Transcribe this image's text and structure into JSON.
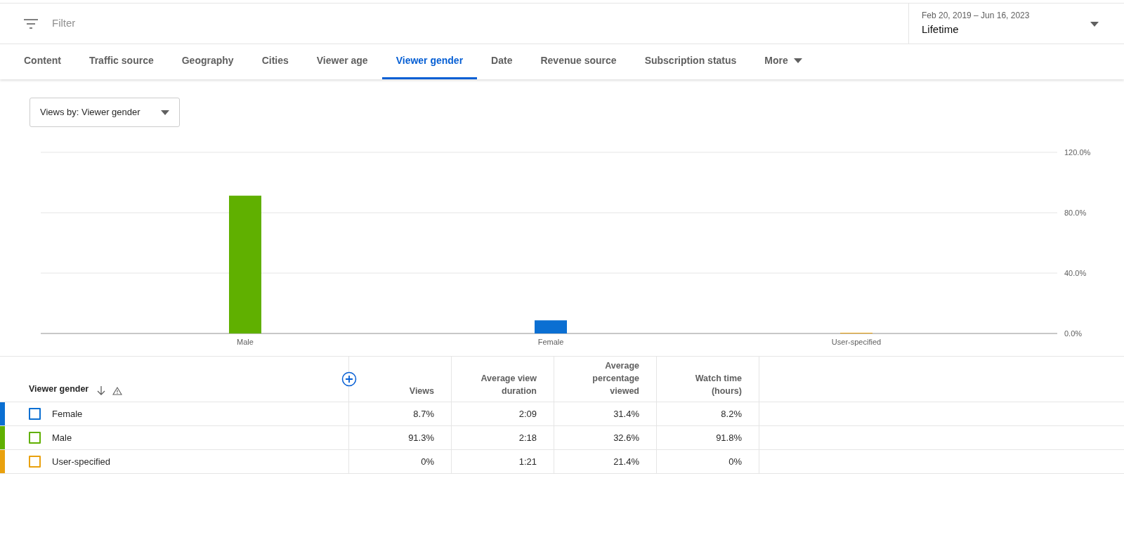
{
  "filter": {
    "placeholder": "Filter"
  },
  "date_range": {
    "range": "Feb 20, 2019 – Jun 16, 2023",
    "period": "Lifetime"
  },
  "tabs": [
    {
      "label": "Content",
      "selected": false
    },
    {
      "label": "Traffic source",
      "selected": false
    },
    {
      "label": "Geography",
      "selected": false
    },
    {
      "label": "Cities",
      "selected": false
    },
    {
      "label": "Viewer age",
      "selected": false
    },
    {
      "label": "Viewer gender",
      "selected": true
    },
    {
      "label": "Date",
      "selected": false
    },
    {
      "label": "Revenue source",
      "selected": false
    },
    {
      "label": "Subscription status",
      "selected": false
    },
    {
      "label": "More",
      "selected": false
    }
  ],
  "metric_select": {
    "value": "Views by: Viewer gender"
  },
  "chart_data": {
    "type": "bar",
    "series": [
      {
        "name": "Male",
        "color": "#60b000",
        "values": [
          91.3,
          null,
          null
        ]
      },
      {
        "name": "Female",
        "color": "#0b6fd2",
        "values": [
          null,
          8.7,
          null
        ]
      },
      {
        "name": "User-specified",
        "color": "#e9a10e",
        "values": [
          null,
          null,
          0.3
        ]
      }
    ],
    "ylim": [
      0,
      120
    ],
    "yticks": [
      {
        "value": 0,
        "label": "0.0%"
      },
      {
        "value": 40,
        "label": "40.0%"
      },
      {
        "value": 80,
        "label": "80.0%"
      },
      {
        "value": 120,
        "label": "120.0%"
      }
    ]
  },
  "table": {
    "columns": [
      "Viewer gender",
      "Views",
      "Average view duration",
      "Average percentage viewed",
      "Watch time (hours)"
    ],
    "rows": [
      {
        "color": "#0b6fd2",
        "checked": false,
        "cells": [
          "Female",
          "8.7%",
          "2:09",
          "31.4%",
          "8.2%"
        ]
      },
      {
        "color": "#60b000",
        "checked": false,
        "cells": [
          "Male",
          "91.3%",
          "2:18",
          "32.6%",
          "91.8%"
        ]
      },
      {
        "color": "#e9a10e",
        "checked": false,
        "cells": [
          "User-specified",
          "0%",
          "1:21",
          "21.4%",
          "0%"
        ]
      }
    ]
  }
}
